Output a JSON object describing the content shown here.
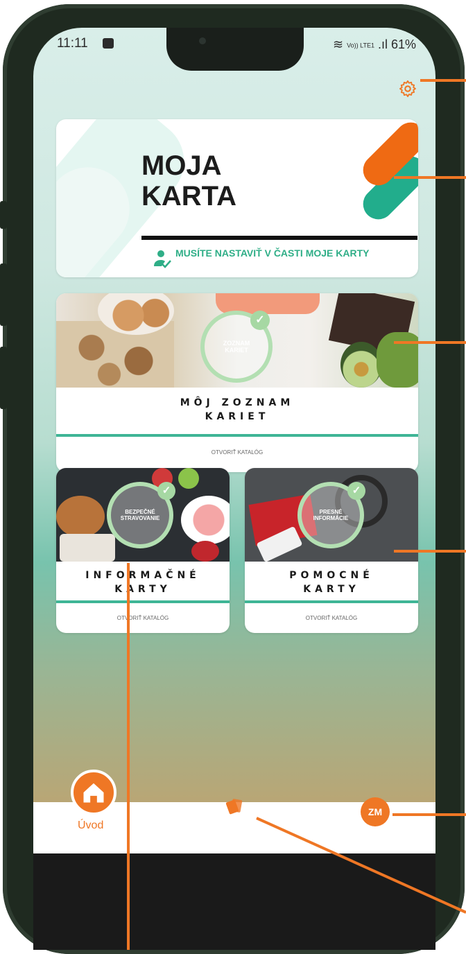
{
  "status_bar": {
    "time": "11:11",
    "carrier": "Vo)) LTE1",
    "battery": "61%"
  },
  "moja_karta": {
    "title_line1": "MOJA",
    "title_line2": "KARTA",
    "note": "MUSÍTE NASTAVIŤ V ČASTI MOJE KARTY"
  },
  "zoznam": {
    "badge_line1": "ZOZNAM",
    "badge_line2": "KARIET",
    "title_line1": "MÔJ ZOZNAM",
    "title_line2": "KARIET",
    "link": "OTVORIŤ KATALÓG"
  },
  "informacne": {
    "badge_line1": "BEZPEČNÉ",
    "badge_line2": "STRAVOVANIE",
    "title_line1": "INFORMAČNÉ",
    "title_line2": "KARTY",
    "link": "OTVORIŤ KATALÓG"
  },
  "pomocne": {
    "badge_line1": "PRESNÉ",
    "badge_line2": "INFORMÁCIE",
    "title_line1": "POMOCNÉ",
    "title_line2": "KARTY",
    "link": "OTVORIŤ KATALÓG"
  },
  "bottom_nav": {
    "home_label": "Úvod",
    "profile_initials": "ZM"
  },
  "icons": [
    "gear-icon",
    "user-check-icon",
    "home-icon",
    "cards-icon",
    "image-icon"
  ],
  "colors": {
    "accent": "#ef7725",
    "green": "#2fae87"
  }
}
